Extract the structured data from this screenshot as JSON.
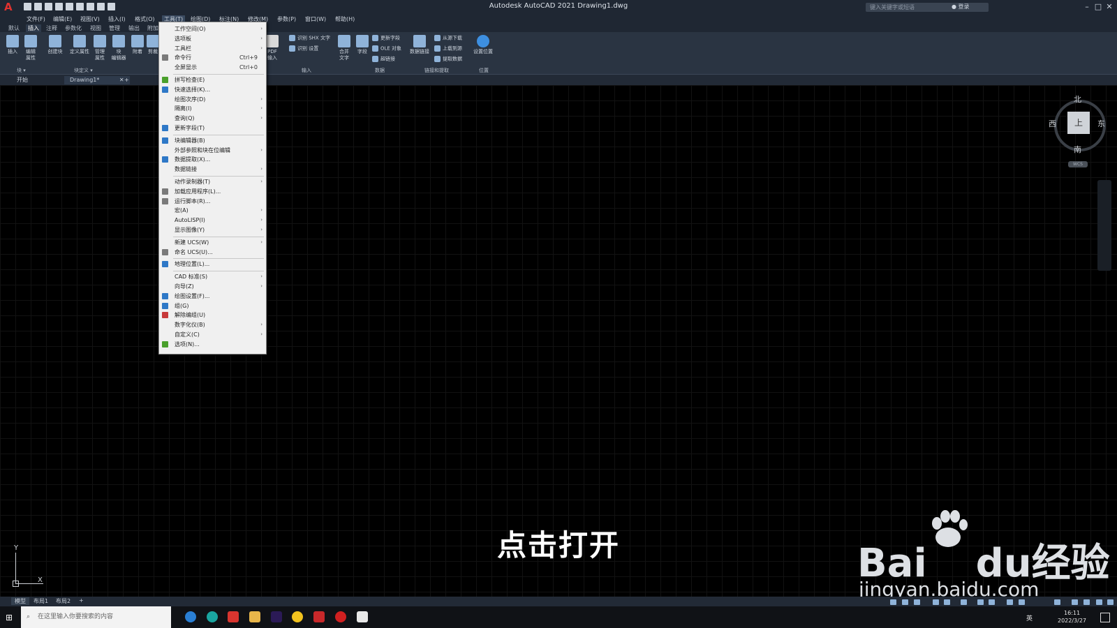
{
  "window": {
    "title": "Autodesk AutoCAD 2021    Drawing1.dwg",
    "search_placeholder": "键入关键字或短语",
    "login": "登录"
  },
  "menubar": [
    "文件(F)",
    "编辑(E)",
    "视图(V)",
    "插入(I)",
    "格式(O)",
    "工具(T)",
    "绘图(D)",
    "标注(N)",
    "修改(M)",
    "参数(P)",
    "窗口(W)",
    "帮助(H)"
  ],
  "ribbon_tabs": [
    "默认",
    "插入",
    "注释",
    "参数化",
    "视图",
    "管理",
    "输出",
    "附加"
  ],
  "ribbon": {
    "insert": "插入",
    "edit_attr": "编辑\n属性",
    "create_block": "创建块",
    "define_attr": "定义属性",
    "manage_attr": "管理\n属性",
    "block_editor": "块\n编辑器",
    "attach": "附着",
    "clip": "剪裁",
    "pdf_import": "PDF\n输入",
    "shx_text": "识别 SHX 文字",
    "recog_settings": "识别 设置",
    "merge_text": "合并\n文字",
    "field": "字段",
    "update_field": "更新字段",
    "ole": "OLE 对象",
    "hyperlink": "超链接",
    "data_link": "数据链接",
    "download_source": "从源下载",
    "upload_source": "上载到源",
    "extract_data": "提取数据",
    "set_location": "设置位置",
    "panel_block": "块 ▾",
    "panel_block_def": "块定义 ▾",
    "panel_import": "输入",
    "panel_data": "数据",
    "panel_link": "链接和提取",
    "panel_location": "位置"
  },
  "file_tabs": [
    "开始",
    "Drawing1*"
  ],
  "dropdown": [
    {
      "label": "工作空间(O)",
      "arrow": true
    },
    {
      "label": "选项板",
      "arrow": true
    },
    {
      "label": "工具栏",
      "arrow": true
    },
    {
      "label": "命令行",
      "shortcut": "Ctrl+9"
    },
    {
      "label": "全屏显示",
      "shortcut": "Ctrl+0"
    },
    {
      "label": "拼写检查(E)"
    },
    {
      "label": "快速选择(K)..."
    },
    {
      "label": "绘图次序(D)",
      "arrow": true
    },
    {
      "label": "隔离(I)",
      "arrow": true
    },
    {
      "label": "查询(Q)",
      "arrow": true
    },
    {
      "label": "更新字段(T)"
    },
    {
      "label": "块编辑器(B)"
    },
    {
      "label": "外部参照和块在位编辑",
      "arrow": true
    },
    {
      "label": "数据提取(X)..."
    },
    {
      "label": "数据链接",
      "arrow": true
    },
    {
      "label": "动作录制器(T)",
      "arrow": true
    },
    {
      "label": "加载应用程序(L)..."
    },
    {
      "label": "运行脚本(R)..."
    },
    {
      "label": "宏(A)",
      "arrow": true
    },
    {
      "label": "AutoLISP(I)",
      "arrow": true
    },
    {
      "label": "显示图像(Y)",
      "arrow": true
    },
    {
      "label": "新建 UCS(W)",
      "arrow": true
    },
    {
      "label": "命名 UCS(U)..."
    },
    {
      "label": "地理位置(L)..."
    },
    {
      "label": "CAD 标准(S)",
      "arrow": true
    },
    {
      "label": "向导(Z)",
      "arrow": true
    },
    {
      "label": "绘图设置(F)..."
    },
    {
      "label": "组(G)"
    },
    {
      "label": "解除编组(U)"
    },
    {
      "label": "数字化仪(B)",
      "arrow": true
    },
    {
      "label": "自定义(C)",
      "arrow": true
    },
    {
      "label": "选项(N)..."
    }
  ],
  "viewcube": {
    "north": "北",
    "south": "南",
    "east": "东",
    "west": "西",
    "face": "上",
    "wcs": "WCS"
  },
  "ucs": {
    "x": "X",
    "y": "Y"
  },
  "subtitle": "点击打开",
  "watermark": {
    "logo_a": "Bai",
    "logo_b": "du",
    "logo_c": "经验",
    "url": "jingyan.baidu.com"
  },
  "layout_tabs": [
    "模型",
    "布局1",
    "布局2",
    "+"
  ],
  "taskbar": {
    "search_placeholder": "在这里输入你要搜索的内容",
    "time": "16:11",
    "date": "2022/3/27",
    "lang": "英"
  }
}
